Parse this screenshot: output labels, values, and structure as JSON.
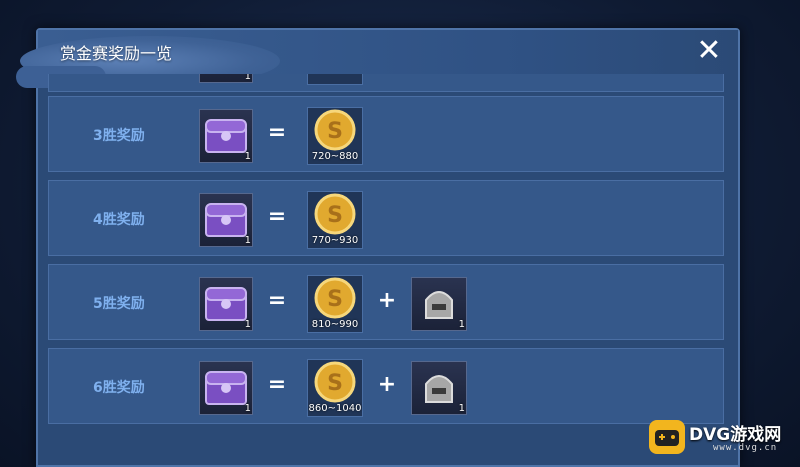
{
  "dialog": {
    "title": "赏金赛奖励一览",
    "close_label": "✕"
  },
  "colors": {
    "panel": "#2b4a76",
    "row": "#35588a",
    "label": "#7fb0ee",
    "coin": "#e1a92f"
  },
  "rewards": [
    {
      "label": "",
      "chest_qty": "1",
      "coin_range": ""
    },
    {
      "label": "3胜奖励",
      "chest_qty": "1",
      "coin_range": "720~880",
      "helmet_qty": ""
    },
    {
      "label": "4胜奖励",
      "chest_qty": "1",
      "coin_range": "770~930",
      "helmet_qty": ""
    },
    {
      "label": "5胜奖励",
      "chest_qty": "1",
      "coin_range": "810~990",
      "helmet_qty": "1"
    },
    {
      "label": "6胜奖励",
      "chest_qty": "1",
      "coin_range": "860~1040",
      "helmet_qty": "1"
    }
  ],
  "symbols": {
    "equals": "=",
    "plus": "+"
  },
  "watermark": {
    "text": "DVG游戏网",
    "sub": "www.dvg.cn"
  }
}
